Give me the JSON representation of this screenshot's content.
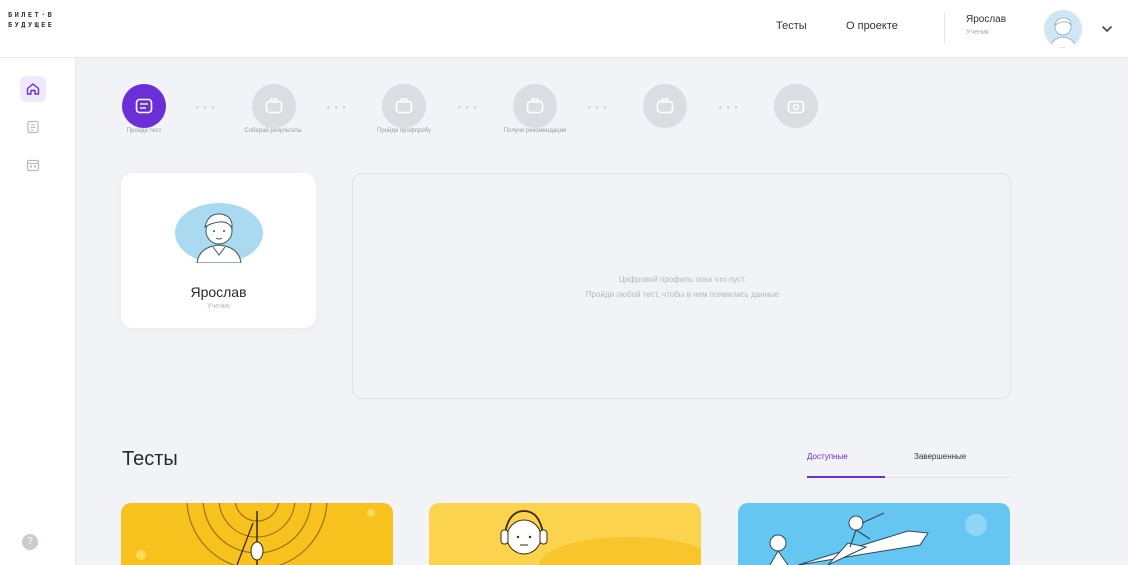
{
  "logo": {
    "line1": "БИЛЕТ·В",
    "line2": "БУДУЩЕЕ"
  },
  "header": {
    "nav": [
      {
        "label": "Тесты"
      },
      {
        "label": "О проекте"
      }
    ],
    "user": {
      "name": "Ярослав",
      "role": "Ученик"
    }
  },
  "steps": [
    {
      "label": "Пройди тест",
      "active": true
    },
    {
      "label": "Соберай результаты",
      "active": false
    },
    {
      "label": "Пройди профпробу",
      "active": false
    },
    {
      "label": "Получи рекомендации",
      "active": false
    },
    {
      "label": "",
      "active": false
    },
    {
      "label": "",
      "active": false
    }
  ],
  "profile": {
    "name": "Ярослав",
    "role": "Ученик"
  },
  "digital_profile": {
    "line1": "Цифровой профиль пока что пуст.",
    "line2": "Пройди любой тест, чтобы в нем появились данные"
  },
  "tests": {
    "title": "Тесты",
    "tabs": [
      {
        "label": "Доступные",
        "active": true
      },
      {
        "label": "Завершенные",
        "active": false
      }
    ],
    "cards": [
      {
        "bg": "#f7c21d"
      },
      {
        "bg": "#fbd34d"
      },
      {
        "bg": "#66c6f2"
      }
    ]
  },
  "colors": {
    "accent": "#6a2fd6",
    "bg": "#f2f3f7"
  }
}
